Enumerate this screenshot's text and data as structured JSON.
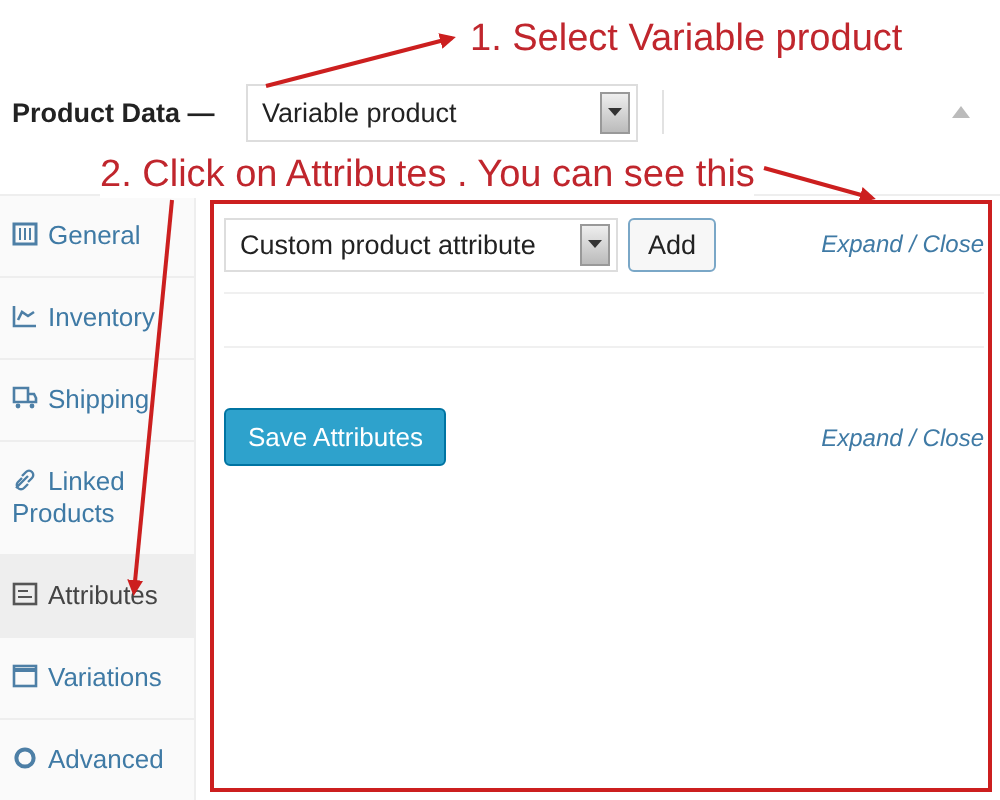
{
  "annotations": [
    {
      "text": "1. Select Variable product"
    },
    {
      "text": "2. Click on Attributes . You can see this"
    }
  ],
  "product_data": {
    "label": "Product Data —",
    "product_type": "Variable product"
  },
  "tabs": [
    {
      "label": "General",
      "kind": "general",
      "selected": false
    },
    {
      "label": "Inventory",
      "kind": "inventory",
      "selected": false
    },
    {
      "label": "Shipping",
      "kind": "shipping",
      "selected": false
    },
    {
      "label": "Linked Products",
      "kind": "linked",
      "selected": false
    },
    {
      "label": "Attributes",
      "kind": "attributes",
      "selected": true
    },
    {
      "label": "Variations",
      "kind": "variations",
      "selected": false
    },
    {
      "label": "Advanced",
      "kind": "advanced",
      "selected": false
    }
  ],
  "attributes_panel": {
    "attribute_select": "Custom product attribute",
    "add_button": "Add",
    "expand_close_top": "Expand / Close",
    "save_button": "Save Attributes",
    "expand_close_bottom": "Expand / Close"
  }
}
